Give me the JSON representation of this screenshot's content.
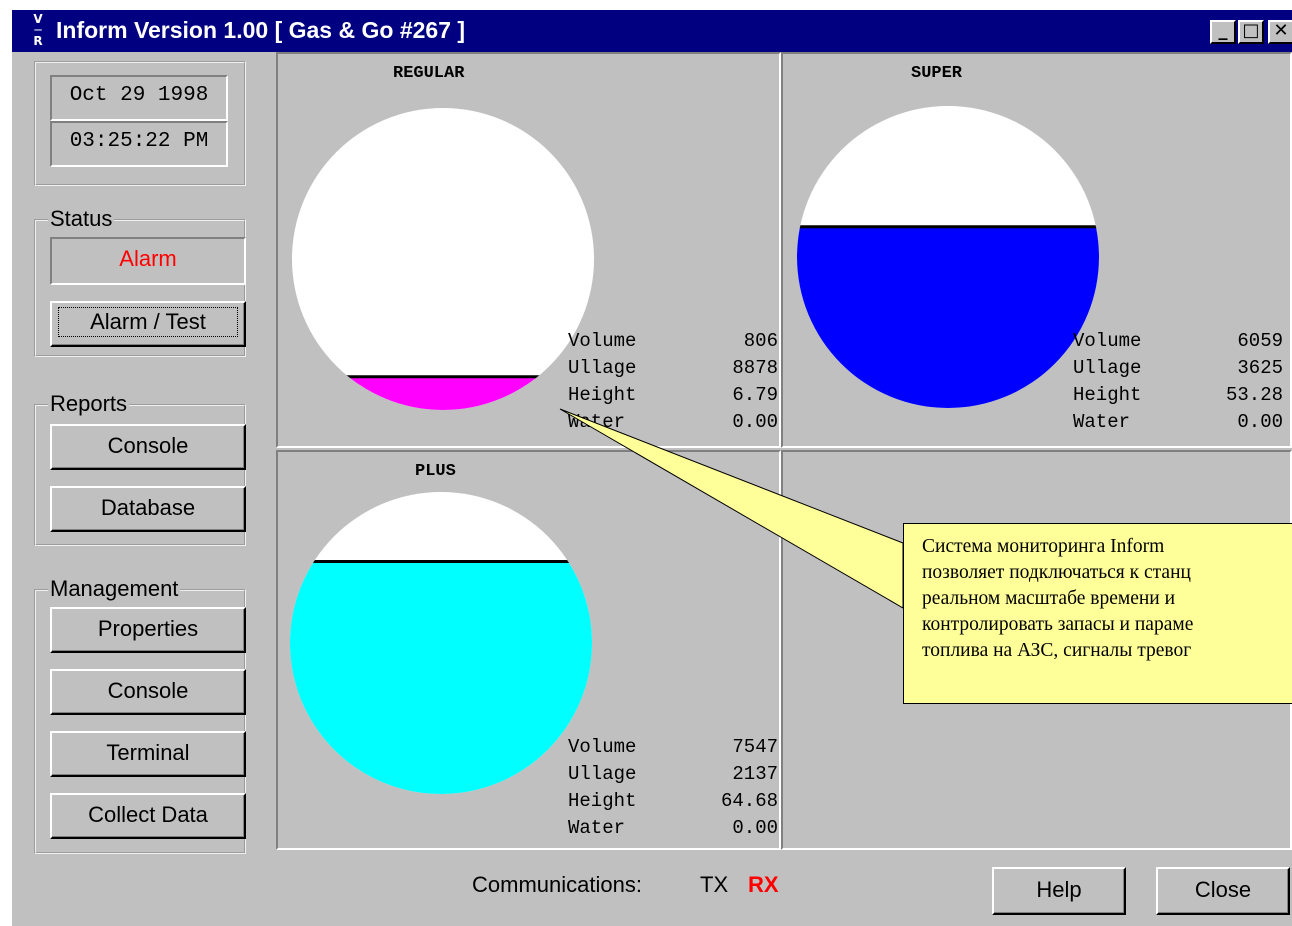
{
  "window": {
    "app_icon_glyph": "V\nR",
    "title": "Inform Version 1.00 [ Gas & Go #267 ]",
    "minimize_glyph": "_",
    "maximize_glyph": "□",
    "close_glyph": "✕"
  },
  "clock": {
    "date": "Oct 29 1998",
    "time": "03:25:22 PM"
  },
  "status": {
    "legend": "Status",
    "value": "Alarm",
    "value_color": "#ff0000",
    "button_label": "Alarm / Test"
  },
  "reports": {
    "legend": "Reports",
    "buttons": [
      "Console",
      "Database"
    ]
  },
  "management": {
    "legend": "Management",
    "buttons": [
      "Properties",
      "Console",
      "Terminal",
      "Collect Data"
    ]
  },
  "tanks": [
    {
      "name": "REGULAR",
      "fill_color": "#ff00ff",
      "level_fraction": 0.11,
      "stats": [
        {
          "label": "Volume",
          "value": "806"
        },
        {
          "label": "Ullage",
          "value": "8878"
        },
        {
          "label": "Height",
          "value": "6.79"
        },
        {
          "label": "Water",
          "value": "0.00"
        }
      ]
    },
    {
      "name": "SUPER",
      "fill_color": "#0000ff",
      "level_fraction": 0.6,
      "stats": [
        {
          "label": "Volume",
          "value": "6059"
        },
        {
          "label": "Ullage",
          "value": "3625"
        },
        {
          "label": "Height",
          "value": "53.28"
        },
        {
          "label": "Water",
          "value": "0.00"
        }
      ]
    },
    {
      "name": "PLUS",
      "fill_color": "#00ffff",
      "level_fraction": 0.77,
      "stats": [
        {
          "label": "Volume",
          "value": "7547"
        },
        {
          "label": "Ullage",
          "value": "2137"
        },
        {
          "label": "Height",
          "value": "64.68"
        },
        {
          "label": "Water",
          "value": "0.00"
        }
      ]
    }
  ],
  "communications": {
    "label": "Communications:",
    "tx": "TX",
    "rx": "RX",
    "rx_color": "#ff0000"
  },
  "footer_buttons": {
    "help": "Help",
    "close": "Close"
  },
  "callout": {
    "lines": [
      "Система мониторинга Inform",
      "позволяет подключаться к станц",
      "реальном масштабе времени  и",
      "контролировать запасы и параме",
      "топлива на АЗС, сигналы тревог"
    ],
    "background": "#ffff99"
  }
}
